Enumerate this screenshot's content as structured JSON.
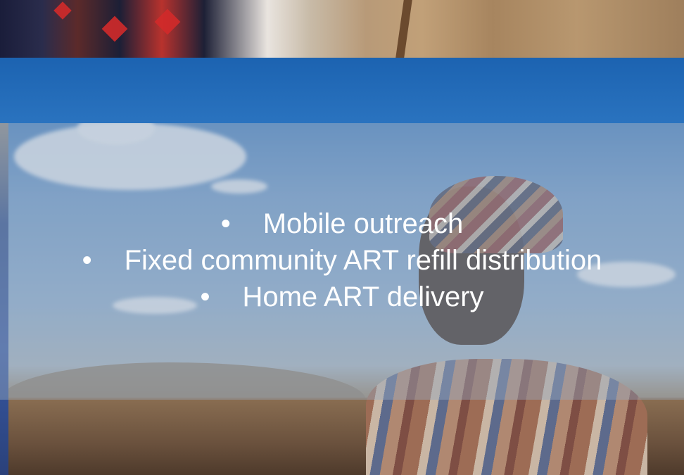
{
  "slide": {
    "bullet_glyph": "•",
    "bullets": [
      "Mobile outreach",
      "Fixed community ART refill distribution",
      "Home ART delivery"
    ]
  },
  "colors": {
    "title_band": "#1c63b1",
    "overlay": "rgba(150, 168, 190, 0.45)",
    "text": "#ffffff"
  }
}
